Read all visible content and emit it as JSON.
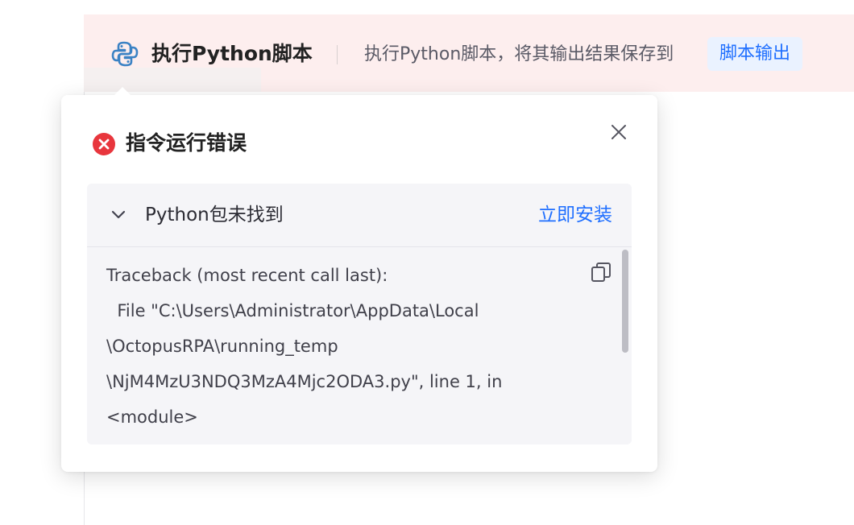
{
  "step": {
    "title": "执行Python脚本",
    "description": "执行Python脚本，将其输出结果保存到",
    "output_tag": "脚本输出"
  },
  "popover": {
    "title": "指令运行错误",
    "error_panel": {
      "title": "Python包未找到",
      "action_label": "立即安装",
      "traceback": [
        "Traceback (most recent call last):",
        "  File \"C:\\Users\\Administrator\\AppData\\Local",
        "\\OctopusRPA\\running_temp",
        "\\NjM4MzU3NDQ3MzA4Mjc2ODA3.py\", line 1, in",
        "<module>"
      ]
    }
  },
  "colors": {
    "accent": "#1f6fff",
    "error": "#e8363d",
    "header_bg": "#fdeeee",
    "python_blue": "#3b82c4"
  },
  "icons": {
    "step": "python-icon",
    "error": "error-circle-icon",
    "close": "close-icon",
    "collapse": "chevron-down-icon",
    "copy": "copy-icon"
  }
}
